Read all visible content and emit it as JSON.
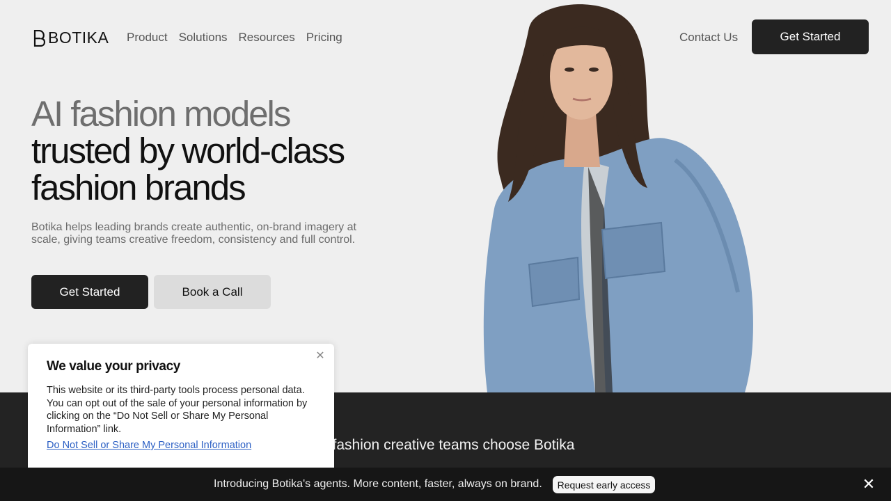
{
  "header": {
    "logo_text": "BOTIKA",
    "nav": [
      "Product",
      "Solutions",
      "Resources",
      "Pricing"
    ],
    "contact_label": "Contact Us",
    "cta_label": "Get Started"
  },
  "hero": {
    "headline_line1": "AI fashion models",
    "headline_line2": "trusted by world-class",
    "headline_line3": "fashion brands",
    "subtitle": "Botika helps leading brands create authentic, on-brand imagery at scale, giving teams creative freedom, consistency and full control.",
    "primary_cta": "Get Started",
    "secondary_cta": "Book a Call"
  },
  "section": {
    "heading_visible": "o fashion creative teams choose Botika"
  },
  "privacy": {
    "title": "We value your privacy",
    "body": "This website or its third-party tools process personal data. You can opt out of the sale of your personal information by clicking on the “Do Not Sell or Share My Personal Information” link.",
    "link": "Do Not Sell or Share My Personal Information"
  },
  "banner": {
    "text": "Introducing Botika's agents. More content, faster, always on brand.",
    "button": "Request early access"
  },
  "colors": {
    "background": "#efefef",
    "dark_button": "#222222",
    "light_button": "#dcdcdc",
    "section_dark": "#232323",
    "banner_dark": "#161616",
    "link_blue": "#2b5fc4",
    "denim": "#7f9fc2"
  },
  "icons": {
    "logo": "botika-b-logo-icon",
    "privacy_close": "close-icon",
    "banner_close": "close-icon"
  }
}
